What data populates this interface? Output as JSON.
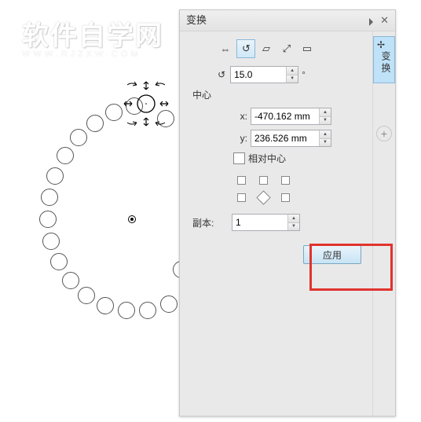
{
  "watermark": {
    "main": "软件自学网",
    "sub": "WWW.RJZXW.COM"
  },
  "panel": {
    "title": "变换",
    "tab_label": "变换",
    "tools": {
      "t1": "⇔",
      "t2": "↻",
      "t3": "▱",
      "t4": "⤢",
      "t5": "▭"
    },
    "rotate": {
      "icon": "↻",
      "value": "15.0",
      "unit": "°"
    },
    "center": {
      "label": "中心",
      "x_label": "x:",
      "x_value": "-470.162 mm",
      "y_label": "y:",
      "y_value": "236.526 mm",
      "relative_label": "相对中心"
    },
    "copies": {
      "label": "副本:",
      "value": "1"
    },
    "apply_label": "应用"
  }
}
